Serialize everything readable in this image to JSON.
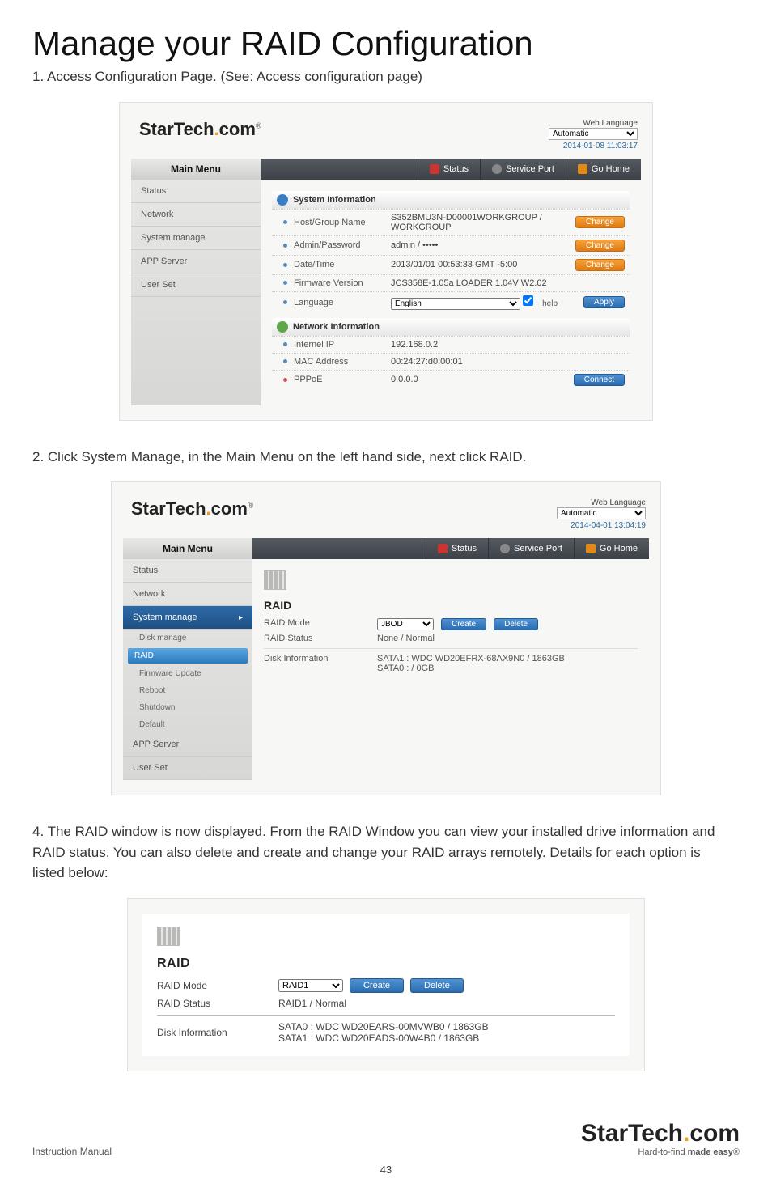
{
  "title": "Manage your RAID Configuration",
  "step1": "1.  Access Configuration Page. (See: Access configuration page)",
  "step2": "2.  Click System Manage, in the Main Menu on the left hand side, next click RAID.",
  "step4": "4.  The RAID window is now displayed.  From the RAID Window you can view your installed drive information and RAID status.  You can also delete and create and change your RAID arrays remotely.  Details for each option is listed below:",
  "brand": {
    "pre": "StarTech",
    "dot": ".",
    "post": "com",
    "reg": "®"
  },
  "weblang_label": "Web Language",
  "weblang_value": "Automatic",
  "shot1": {
    "timestamp": "2014-01-08 11:03:17",
    "toolbar": {
      "mainmenu": "Main Menu",
      "status": "Status",
      "service": "Service Port",
      "gohome": "Go Home"
    },
    "menu": [
      "Status",
      "Network",
      "System manage",
      "APP Server",
      "User Set"
    ],
    "sect1": "System Information",
    "rows": [
      {
        "k": "Host/Group Name",
        "v": "S352BMU3N-D00001WORKGROUP / WORKGROUP",
        "btn": "Change"
      },
      {
        "k": "Admin/Password",
        "v": "admin / •••••",
        "btn": "Change"
      },
      {
        "k": "Date/Time",
        "v": "2013/01/01 00:53:33 GMT -5:00",
        "btn": "Change"
      },
      {
        "k": "Firmware Version",
        "v": "JCS358E-1.05a LOADER 1.04V W2.02",
        "btn": ""
      },
      {
        "k": "Language",
        "v": "English",
        "help": "help",
        "btn": "Apply",
        "btnblue": true,
        "select": true
      }
    ],
    "sect2": "Network Information",
    "rows2": [
      {
        "k": "Internel IP",
        "v": "192.168.0.2",
        "btn": ""
      },
      {
        "k": "MAC Address",
        "v": "00:24:27:d0:00:01",
        "btn": ""
      },
      {
        "k": "PPPoE",
        "v": "0.0.0.0",
        "btn": "Connect",
        "btnblue": true,
        "red": true
      }
    ]
  },
  "shot2": {
    "timestamp": "2014-04-01 13:04:19",
    "toolbar": {
      "mainmenu": "Main Menu",
      "status": "Status",
      "service": "Service Port",
      "gohome": "Go Home"
    },
    "menu": {
      "top": [
        "Status",
        "Network"
      ],
      "selected": "System manage",
      "subs": [
        "Disk manage",
        "RAID",
        "Firmware Update",
        "Reboot",
        "Shutdown",
        "Default"
      ],
      "bottom": [
        "APP Server",
        "User Set"
      ]
    },
    "raid": {
      "heading": "RAID",
      "mode_label": "RAID Mode",
      "mode_value": "JBOD",
      "create": "Create",
      "delete": "Delete",
      "status_label": "RAID Status",
      "status_value": "None / Normal",
      "disk_label": "Disk Information",
      "disk_lines": [
        "SATA1 : WDC WD20EFRX-68AX9N0 / 1863GB",
        "SATA0 : / 0GB"
      ]
    }
  },
  "raidcard": {
    "heading": "RAID",
    "mode_label": "RAID Mode",
    "mode_value": "RAID1",
    "create": "Create",
    "delete": "Delete",
    "status_label": "RAID Status",
    "status_value": "RAID1 / Normal",
    "disk_label": "Disk Information",
    "disk_lines": [
      "SATA0 : WDC WD20EARS-00MVWB0 / 1863GB",
      "SATA1 : WDC WD20EADS-00W4B0 / 1863GB"
    ]
  },
  "footer": {
    "manual": "Instruction Manual",
    "tagline_pre": "Hard-to-find ",
    "tagline_bold": "made easy",
    "tagline_reg": "®",
    "page": "43"
  }
}
